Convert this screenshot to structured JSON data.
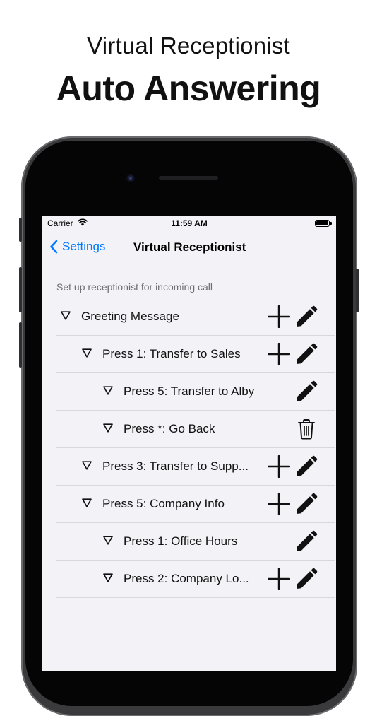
{
  "promo": {
    "headline_top": "Virtual Receptionist",
    "headline_main": "Auto Answering"
  },
  "status_bar": {
    "carrier": "Carrier",
    "time": "11:59 AM"
  },
  "nav": {
    "back_label": "Settings",
    "title": "Virtual Receptionist"
  },
  "section": {
    "header": "Set up receptionist for incoming call"
  },
  "menu_items": [
    {
      "label": "Greeting Message",
      "level": 0,
      "actions": [
        "add",
        "edit"
      ]
    },
    {
      "label": "Press 1: Transfer to Sales",
      "level": 1,
      "actions": [
        "add",
        "edit"
      ]
    },
    {
      "label": "Press 5: Transfer to Alby",
      "level": 2,
      "actions": [
        "edit"
      ]
    },
    {
      "label": "Press *: Go Back",
      "level": 2,
      "actions": [
        "delete"
      ]
    },
    {
      "label": "Press 3: Transfer to Supp...",
      "level": 1,
      "actions": [
        "add",
        "edit"
      ]
    },
    {
      "label": "Press 5: Company Info",
      "level": 1,
      "actions": [
        "add",
        "edit"
      ]
    },
    {
      "label": "Press 1: Office Hours",
      "level": 2,
      "actions": [
        "edit"
      ]
    },
    {
      "label": "Press 2: Company Lo...",
      "level": 2,
      "actions": [
        "add",
        "edit"
      ]
    }
  ],
  "colors": {
    "accent": "#007aff",
    "screen_background": "#f2f2f7",
    "separator": "#d8d8dc"
  },
  "icons": {
    "expand": "triangle-down-icon",
    "add": "plus-icon",
    "edit": "pencil-icon",
    "delete": "trash-icon",
    "back": "chevron-left-icon"
  }
}
